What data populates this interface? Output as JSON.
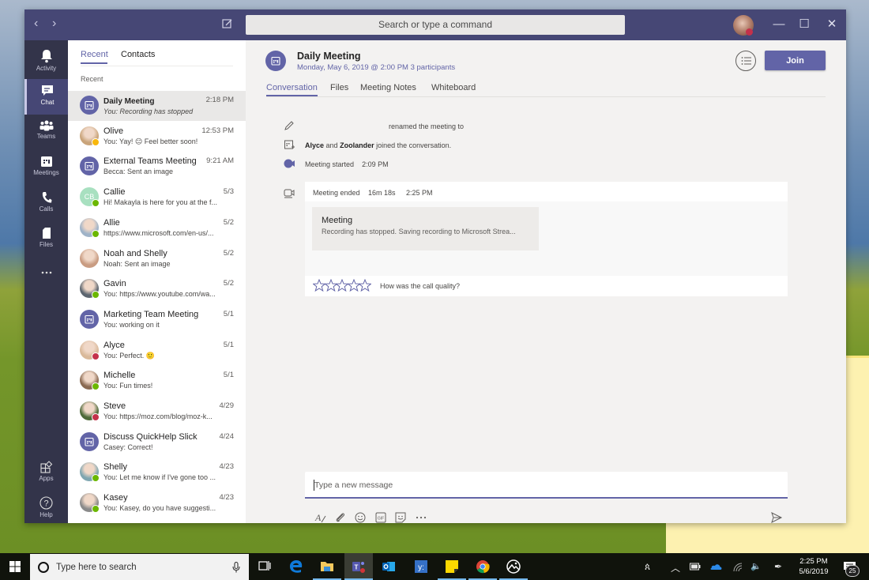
{
  "window": {
    "search_placeholder": "Search or type a command",
    "controls": {
      "minimize": "—",
      "maximize": "☐",
      "close": "✕"
    }
  },
  "appbar": {
    "items": [
      {
        "id": "activity",
        "label": "Activity",
        "icon": "bell-icon"
      },
      {
        "id": "chat",
        "label": "Chat",
        "icon": "chat-icon",
        "active": true
      },
      {
        "id": "teams",
        "label": "Teams",
        "icon": "teams-icon"
      },
      {
        "id": "meetings",
        "label": "Meetings",
        "icon": "calendar-icon"
      },
      {
        "id": "calls",
        "label": "Calls",
        "icon": "phone-icon"
      },
      {
        "id": "files",
        "label": "Files",
        "icon": "file-icon"
      },
      {
        "id": "more",
        "label": "",
        "icon": "more-icon"
      },
      {
        "id": "apps",
        "label": "Apps",
        "icon": "apps-icon"
      },
      {
        "id": "help",
        "label": "Help",
        "icon": "help-icon"
      }
    ]
  },
  "chatlist": {
    "tabs": [
      {
        "label": "Recent",
        "active": true
      },
      {
        "label": "Contacts"
      }
    ],
    "section": "Recent",
    "items": [
      {
        "name": "Daily Meeting",
        "time": "2:18 PM",
        "preview": "You: Recording has stopped",
        "type": "meeting",
        "selected": true
      },
      {
        "name": "Olive",
        "time": "12:53 PM",
        "preview": "You: Yay! 😑 Feel better soon!",
        "status": "away",
        "avatar_color": "#c9a47a"
      },
      {
        "name": "External Teams Meeting",
        "time": "9:21 AM",
        "preview": "Becca: Sent an image",
        "type": "meeting"
      },
      {
        "name": "Callie",
        "time": "5/3",
        "preview": "Hi! Makayla is here for you at the f...",
        "initials": "CB",
        "status": "available"
      },
      {
        "name": "Allie",
        "time": "5/2",
        "preview": "https://www.microsoft.com/en-us/...",
        "status": "available",
        "avatar_color": "#9fb3c8"
      },
      {
        "name": "Noah and Shelly",
        "time": "5/2",
        "preview": "Noah: Sent an image",
        "avatar_color": "#c99c82"
      },
      {
        "name": "Gavin",
        "time": "5/2",
        "preview": "You: https://www.youtube.com/wa...",
        "status": "available",
        "avatar_color": "#5d6670"
      },
      {
        "name": "Marketing Team Meeting",
        "time": "5/1",
        "preview": "You: working on it",
        "type": "meeting"
      },
      {
        "name": "Alyce",
        "time": "5/1",
        "preview": "You: Perfect. 🙂",
        "status": "busy",
        "avatar_color": "#d9b99a"
      },
      {
        "name": "Michelle",
        "time": "5/1",
        "preview": "You: Fun times!",
        "status": "available",
        "avatar_color": "#8a6a52"
      },
      {
        "name": "Steve",
        "time": "4/29",
        "preview": "You: https://moz.com/blog/moz-k...",
        "status": "busy",
        "avatar_color": "#4e6a3a"
      },
      {
        "name": "Discuss QuickHelp Slick",
        "time": "4/24",
        "preview": "Casey: Correct!",
        "type": "meeting"
      },
      {
        "name": "Shelly",
        "time": "4/23",
        "preview": "You: Let me know if I've gone too ...",
        "status": "available",
        "avatar_color": "#7fa6b0"
      },
      {
        "name": "Kasey",
        "time": "4/23",
        "preview": "You: Kasey, do you have suggesti...",
        "status": "available",
        "avatar_color": "#8a8a8a"
      }
    ]
  },
  "main": {
    "title": "Daily Meeting",
    "subtitle": "Monday, May 6, 2019 @ 2:00 PM 3 participants",
    "join_label": "Join",
    "tabs": [
      {
        "label": "Conversation",
        "active": true
      },
      {
        "label": "Files"
      },
      {
        "label": "Meeting Notes"
      },
      {
        "label": "Whiteboard"
      }
    ],
    "events": {
      "renamed": "renamed the meeting to",
      "joined_name1": "Alyce",
      "joined_and": "and",
      "joined_name2": "Zoolander",
      "joined_rest": "joined the conversation.",
      "started_label": "Meeting started",
      "started_time": "2:09 PM",
      "ended_label": "Meeting ended",
      "ended_duration": "16m 18s",
      "ended_time": "2:25 PM"
    },
    "recording": {
      "title": "Meeting",
      "text": "Recording has stopped. Saving recording to Microsoft Strea..."
    },
    "rating": {
      "question": "How was the call quality?",
      "stars": 5,
      "value": 0
    },
    "composer": {
      "placeholder": "Type a new message"
    },
    "accent": "#6264a7"
  },
  "taskbar": {
    "search_placeholder": "Type here to search",
    "apps": [
      "task-view",
      "edge",
      "file-explorer",
      "teams",
      "outlook",
      "yammer",
      "sticky-notes",
      "chrome",
      "photos"
    ],
    "clock_time": "2:25 PM",
    "clock_date": "5/6/2019",
    "notification_count": "25"
  }
}
